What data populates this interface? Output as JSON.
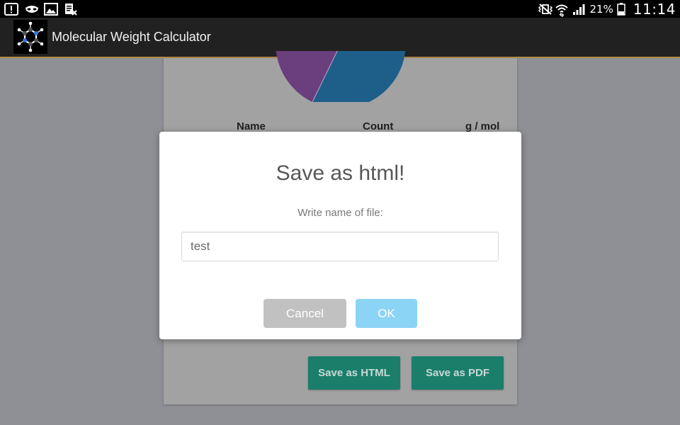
{
  "status_bar": {
    "battery_percent": "21%",
    "time": "11:14",
    "left_icons": [
      "alert-icon",
      "incognito-mask-icon",
      "gallery-icon",
      "document-close-icon"
    ],
    "right_icons": [
      "vibrate-muted-icon",
      "wifi-icon",
      "signal-icon",
      "battery-icon"
    ]
  },
  "action_bar": {
    "title": "Molecular Weight Calculator",
    "logo_icon": "molecule-icon"
  },
  "table_header": {
    "name": "Name",
    "count": "Count",
    "gmol": "g / mol"
  },
  "actions": {
    "save_html": "Save as HTML",
    "save_pdf": "Save as PDF"
  },
  "dialog": {
    "title": "Save as html!",
    "text": "Write name of file:",
    "input_value": "test",
    "cancel_label": "Cancel",
    "ok_label": "OK"
  },
  "colors": {
    "overlay_bg": "#8f9095",
    "action_button": "#1a7e6b",
    "ok_button": "#8cd4f5",
    "cancel_button": "#c1c1c1",
    "pie_blue": "#1e5f8a",
    "pie_purple": "#6b3e7d"
  }
}
